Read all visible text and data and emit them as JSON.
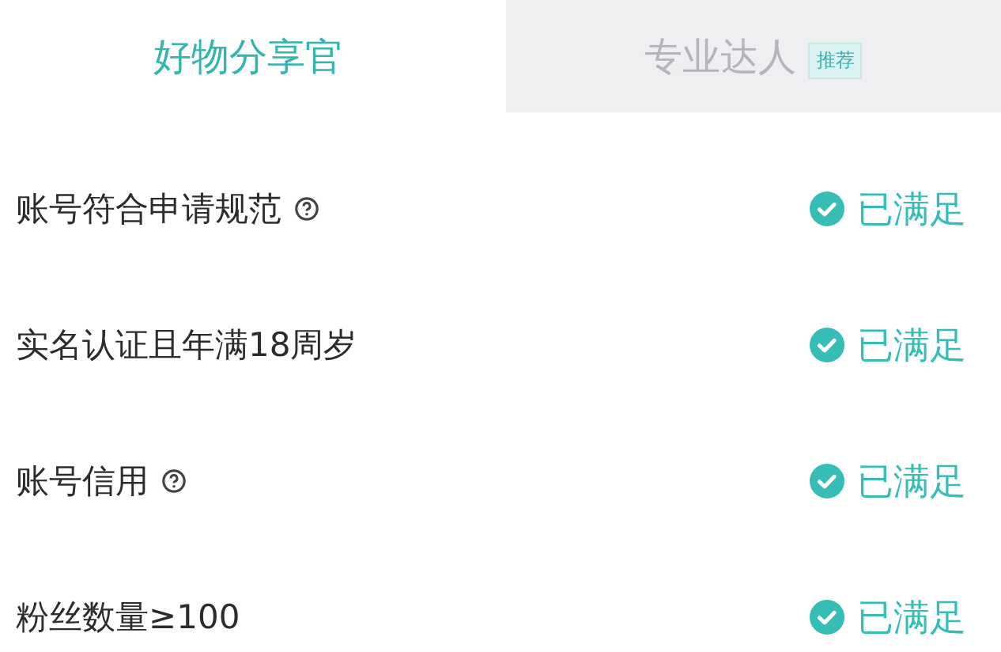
{
  "tabs": [
    {
      "label": "好物分享官",
      "selected": true
    },
    {
      "label": "专业达人",
      "selected": false,
      "badge": "推荐"
    }
  ],
  "requirements": [
    {
      "label": "账号符合申请规范",
      "help": true,
      "status": "已满足",
      "met": true
    },
    {
      "label": "实名认证且年满18周岁",
      "help": false,
      "status": "已满足",
      "met": true
    },
    {
      "label": "账号信用",
      "help": true,
      "status": "已满足",
      "met": true
    },
    {
      "label": "粉丝数量≥100",
      "help": false,
      "status": "已满足",
      "met": true
    }
  ]
}
